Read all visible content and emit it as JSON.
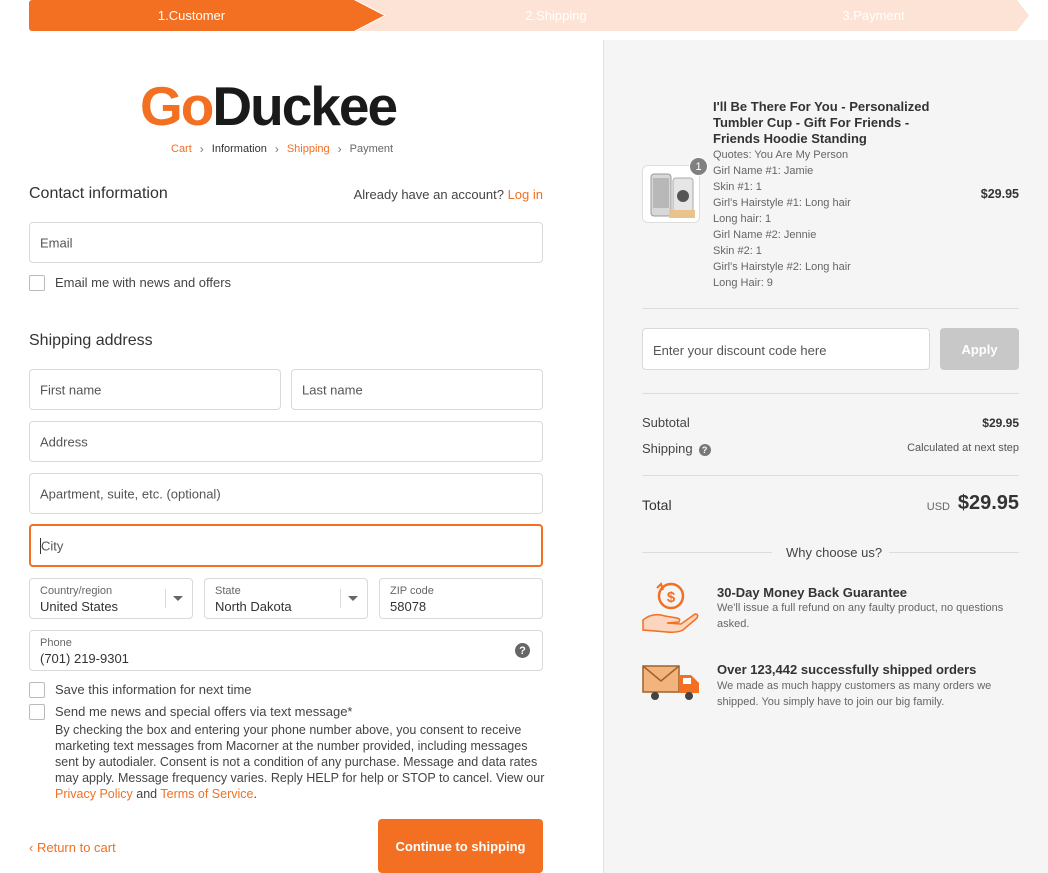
{
  "steps": [
    "1.Customer",
    "2.Shipping",
    "3.Payment"
  ],
  "brand": {
    "go": "Go",
    "duckee": "Duckee"
  },
  "breadcrumb": {
    "cart": "Cart",
    "information": "Information",
    "shipping": "Shipping",
    "payment": "Payment"
  },
  "contact": {
    "title": "Contact information",
    "account_prompt": "Already have an account?",
    "login": "Log in",
    "email_placeholder": "Email",
    "news_label": "Email me with news and offers"
  },
  "shipping": {
    "title": "Shipping address",
    "first_name": "First name",
    "last_name": "Last name",
    "address": "Address",
    "apartment": "Apartment, suite, etc. (optional)",
    "city": "City",
    "country_label": "Country/region",
    "country_value": "United States",
    "state_label": "State",
    "state_value": "North Dakota",
    "zip_label": "ZIP code",
    "zip_value": "58078",
    "phone_label": "Phone",
    "phone_value": "(701) 219-9301"
  },
  "options": {
    "save_info": "Save this information for next time",
    "sms_label": "Send me news and special offers via text message*",
    "consent_text": "By checking the box and entering your phone number above, you consent to receive marketing text messages from Macorner at the number provided, including messages sent by autodialer. Consent is not a condition of any purchase. Message and data rates may apply. Message frequency varies. Reply HELP for help or STOP to cancel. View our",
    "privacy": "Privacy Policy",
    "and": "and",
    "terms": "Terms of Service",
    "period": "."
  },
  "actions": {
    "return": "Return to cart",
    "continue": "Continue to shipping"
  },
  "cart": {
    "quantity": "1",
    "title": "I'll Be There For You - Personalized Tumbler Cup - Gift For Friends - Friends Hoodie Standing",
    "options": [
      "Quotes: You Are My Person",
      "Girl Name #1: Jamie",
      "Skin #1: 1",
      "Girl's Hairstyle #1: Long hair",
      "Long hair: 1",
      "Girl Name #2: Jennie",
      "Skin #2: 1",
      "Girl's Hairstyle #2: Long hair",
      "Long Hair: 9"
    ],
    "price": "$29.95"
  },
  "discount": {
    "placeholder": "Enter your discount code here",
    "apply": "Apply"
  },
  "summary": {
    "subtotal_label": "Subtotal",
    "subtotal_value": "$29.95",
    "shipping_label": "Shipping",
    "shipping_value": "Calculated at next step",
    "total_label": "Total",
    "currency": "USD",
    "total_value": "$29.95"
  },
  "why": {
    "title": "Why choose us?",
    "features": [
      {
        "title": "30-Day Money Back Guarantee",
        "desc": "We'll issue a full refund on any faulty product, no questions asked."
      },
      {
        "title": "Over 123,442 successfully shipped orders",
        "desc": "We made as much happy customers as many orders we shipped. You simply have to join our big family."
      }
    ]
  },
  "colors": {
    "accent": "#f36f21",
    "accent_light": "#fde3d5",
    "panel": "#f5f5f5"
  }
}
